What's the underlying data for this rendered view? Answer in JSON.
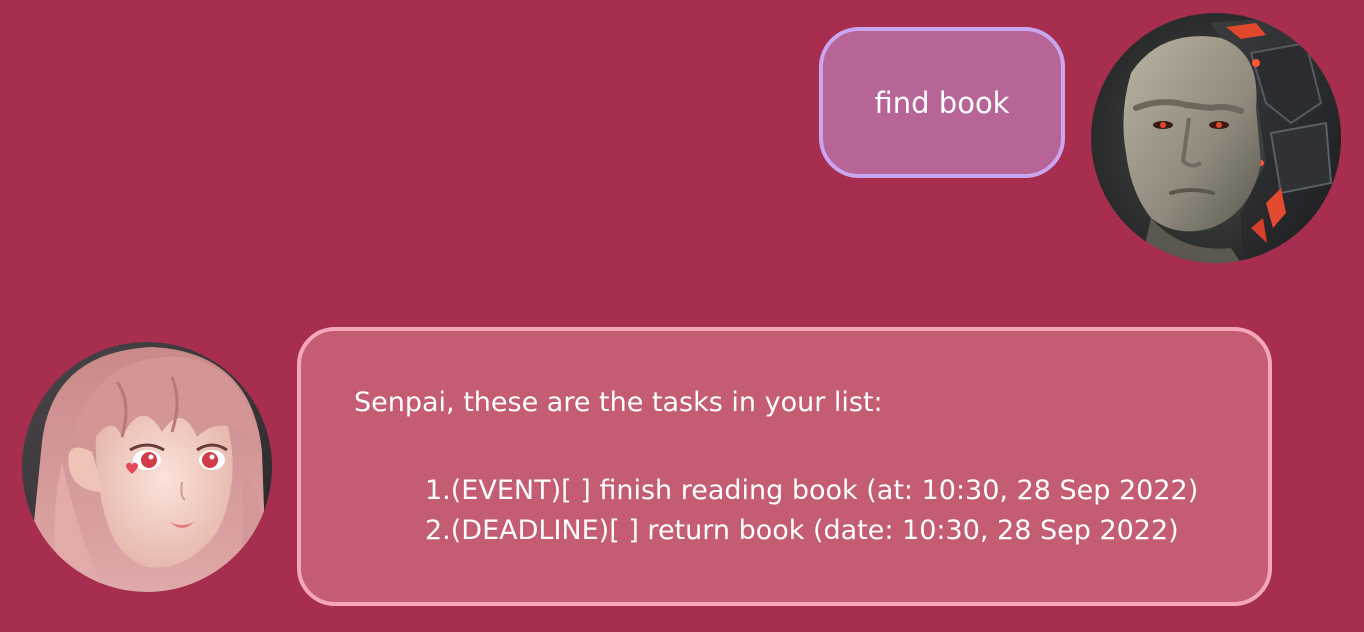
{
  "conversation": {
    "user_message": {
      "text": "find book",
      "avatar": "cyborg-man-avatar"
    },
    "bot_message": {
      "intro": "Senpai, these are the tasks in your list:",
      "tasks": [
        "1.(EVENT)[ ] finish reading book (at: 10:30, 28 Sep 2022)",
        "2.(DEADLINE)[ ] return book (date: 10:30, 28 Sep 2022)"
      ],
      "avatar": "anime-girl-avatar"
    }
  },
  "colors": {
    "background": "#a82e4f",
    "user_bubble_fill": "#b76496",
    "user_bubble_border": "#c9a6ef",
    "bot_bubble_fill": "#c45c72",
    "bot_bubble_border": "#f6a6ba",
    "text": "#ffffff"
  }
}
